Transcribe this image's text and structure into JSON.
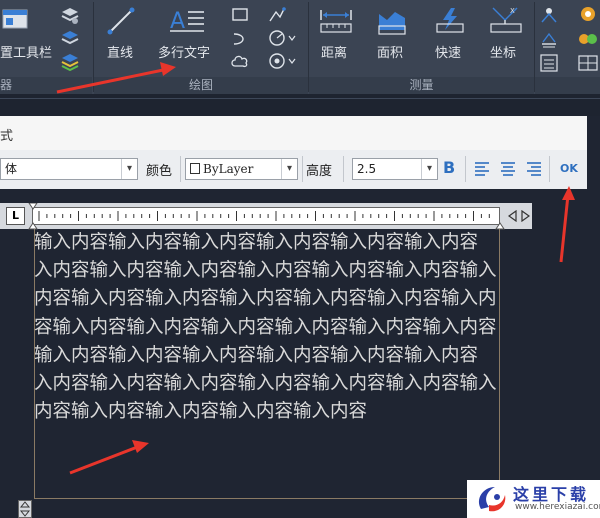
{
  "ribbon": {
    "left_partial_label": "置工具栏",
    "left_partial_title": "器",
    "draw": {
      "title": "绘图",
      "line": "直线",
      "mtext": "多行文字"
    },
    "measure": {
      "title": "测量",
      "distance": "距离",
      "area": "面积",
      "quick": "快速",
      "coordinate": "坐标"
    }
  },
  "text_format": {
    "title_partial": "式",
    "font_value": "体",
    "color_label": "颜色",
    "color_value": "ByLayer",
    "height_label": "高度",
    "height_value": "2.5",
    "bold": "B",
    "ok": "OK"
  },
  "ruler": {
    "tab_label": "L"
  },
  "editor": {
    "lines": [
      "输入内容输入内容输入内容输入内容输入内容输入内容",
      "入内容输入内容输入内容输入内容输入内容输入内容输入",
      "内容输入内容输入内容输入内容输入内容输入内容输入内",
      "容输入内容输入内容输入内容输入内容输入内容输入内容",
      "输入内容输入内容输入内容输入内容输入内容输入内容",
      "入内容输入内容输入内容输入内容输入内容输入内容输入",
      "内容输入内容输入内容输入内容输入内容"
    ]
  },
  "watermark": {
    "cn": "这里下载",
    "en": "www.herexiazai.com"
  },
  "colors": {
    "ribbon_bg": "#3b4453",
    "canvas_bg": "#1f2532",
    "accent_blue": "#3a7fd5",
    "annotation_red": "#e8352b"
  }
}
